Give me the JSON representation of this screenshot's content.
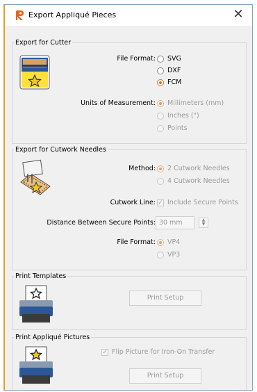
{
  "window": {
    "title": "Export Appliqué Pieces",
    "close_glyph": "✕"
  },
  "cutter": {
    "title": "Export for Cutter",
    "file_format_label": "File Format:",
    "formats": [
      "SVG",
      "DXF",
      "FCM"
    ],
    "selected_format": "FCM",
    "units_label": "Units of Measurement:",
    "units": [
      "Millimeters (mm)",
      "Inches (\")",
      "Points"
    ],
    "selected_unit": "Millimeters (mm)",
    "icon": "cutter-icon"
  },
  "cutwork": {
    "title": "Export for Cutwork Needles",
    "method_label": "Method:",
    "methods": [
      "2 Cutwork Needles",
      "4 Cutwork Needles"
    ],
    "selected_method": "2 Cutwork Needles",
    "cutwork_line_label": "Cutwork Line:",
    "secure_points_label": "Include Secure Points",
    "secure_points_checked": true,
    "distance_label": "Distance Between Secure Points:",
    "distance_value": "30 mm",
    "file_format_label": "File Format:",
    "formats": [
      "VP4",
      "VP3"
    ],
    "selected_format": "VP4",
    "icon": "cutwork-needles-icon"
  },
  "templates": {
    "title": "Print Templates",
    "print_setup_label": "Print Setup",
    "icon": "printer-template-icon"
  },
  "pictures": {
    "title": "Print Appliqué Pictures",
    "flip_label": "Flip Picture for Iron-On Transfer",
    "flip_checked": true,
    "print_setup_label": "Print Setup",
    "icon": "printer-picture-icon"
  },
  "colors": {
    "accent": "#e07020",
    "star": "#f2c81e",
    "printer": "#2b5797"
  }
}
